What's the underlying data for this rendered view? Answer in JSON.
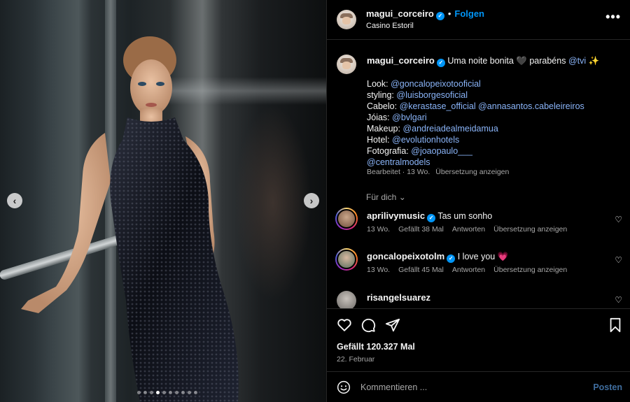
{
  "post": {
    "username": "magui_corceiro",
    "location": "Casino Estoril",
    "follow_label": "Folgen",
    "separator": "•",
    "more_icon": "more-horizontal-icon",
    "verified_icon": "verified-badge-icon"
  },
  "carousel": {
    "prev_icon": "chevron-left-icon",
    "next_icon": "chevron-right-icon",
    "prev_glyph": "‹",
    "next_glyph": "›",
    "dot_count": 10,
    "active_dot": 3
  },
  "caption": {
    "username": "magui_corceiro",
    "text_before": "Uma noite bonita 🖤 parabéns",
    "tvi": "@tvi",
    "text_after": "✨",
    "credits": [
      {
        "label": "Look:",
        "mentions": [
          "@goncalopeixotooficial"
        ]
      },
      {
        "label": "styling:",
        "mentions": [
          "@luisborgesoficial"
        ]
      },
      {
        "label": "Cabelo:",
        "mentions": [
          "@kerastase_official",
          "@annasantos.cabeleireiros"
        ]
      },
      {
        "label": "Jóias:",
        "mentions": [
          "@bvlgari"
        ]
      },
      {
        "label": "Makeup:",
        "mentions": [
          "@andreiadealmeidamua"
        ]
      },
      {
        "label": "Hotel:",
        "mentions": [
          "@evolutionhotels"
        ]
      },
      {
        "label": "Fotografia:",
        "mentions": [
          "@joaopaulo___"
        ]
      },
      {
        "label": "",
        "mentions": [
          "@centralmodels"
        ]
      }
    ],
    "meta_edited": "Bearbeitet · 13 Wo.",
    "meta_translate": "Übersetzung anzeigen"
  },
  "for_you": "Für dich",
  "comments": [
    {
      "username": "aprilivymusic",
      "verified": true,
      "text": "Tas um sonho",
      "age": "13 Wo.",
      "likes": "Gefällt 38 Mal",
      "reply": "Antworten",
      "translate": "Übersetzung anzeigen"
    },
    {
      "username": "goncalopeixotolm",
      "verified": true,
      "text": "I love you 💗",
      "age": "13 Wo.",
      "likes": "Gefällt 45 Mal",
      "reply": "Antworten",
      "translate": "Übersetzung anzeigen"
    },
    {
      "username": "risangelsuarez",
      "verified": false,
      "text": "",
      "age": "",
      "likes": "",
      "reply": "",
      "translate": ""
    }
  ],
  "actions": {
    "like_icon": "heart-icon",
    "comment_icon": "comment-bubble-icon",
    "share_icon": "send-paper-plane-icon",
    "save_icon": "bookmark-icon",
    "likes_text": "Gefällt 120.327 Mal",
    "date": "22. Februar"
  },
  "composer": {
    "emoji_icon": "emoji-smiley-icon",
    "placeholder": "Kommentieren ...",
    "post_label": "Posten"
  },
  "colors": {
    "accent": "#0095f6",
    "post_disabled": "#3f6d9e",
    "mention": "#8ab4f8",
    "secondary_text": "#a8a8a8",
    "divider": "#262626"
  }
}
